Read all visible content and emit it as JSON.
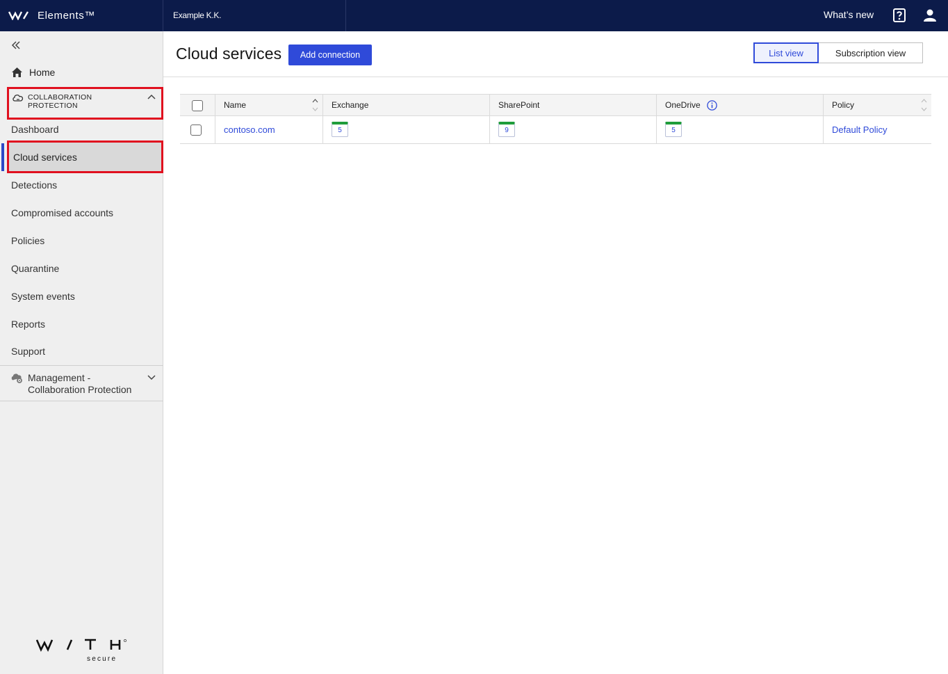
{
  "topbar": {
    "brand": "Elements™",
    "organization": "Example K.K.",
    "whats_new": "What’s new"
  },
  "sidebar": {
    "home": "Home",
    "section": "COLLABORATION PROTECTION",
    "items": [
      "Dashboard",
      "Cloud services",
      "Detections",
      "Compromised accounts",
      "Policies",
      "Quarantine",
      "System events",
      "Reports",
      "Support"
    ],
    "active_item": "Cloud services",
    "management": "Management - Collaboration Protection"
  },
  "main": {
    "title": "Cloud services",
    "add_button": "Add connection",
    "views": [
      "List view",
      "Subscription view"
    ],
    "selected_view": "List view"
  },
  "table": {
    "columns": [
      "Name",
      "Exchange",
      "SharePoint",
      "OneDrive",
      "Policy"
    ],
    "rows": [
      {
        "name": "contoso.com",
        "exchange": "5",
        "sharepoint": "9",
        "onedrive": "5",
        "policy": "Default Policy",
        "checked": false
      }
    ]
  },
  "colors": {
    "topbar_bg": "#0c1b4a",
    "accent": "#2f4ad9",
    "highlight_border": "#e0101f",
    "badge_green": "#1f9d3b"
  },
  "icons": [
    "withsecure-logo-mark",
    "help-icon",
    "user-icon",
    "collapse-double-chevron-icon",
    "home-icon",
    "cloud-icon",
    "chevron-up-icon",
    "chevron-down-icon",
    "cloud-gear-icon",
    "info-icon",
    "sort-icon"
  ],
  "footer": {
    "logo_text": "WITH",
    "logo_sub": "secure"
  }
}
